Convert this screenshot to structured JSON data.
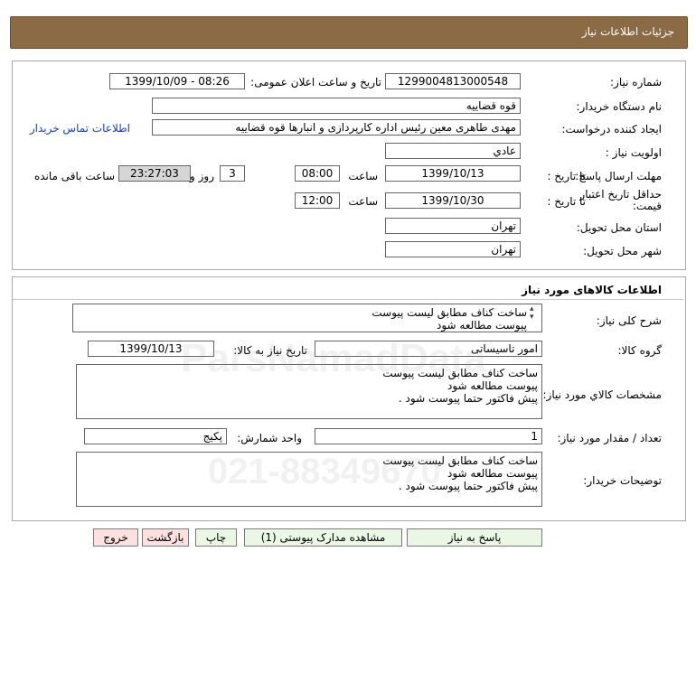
{
  "header": {
    "title": "جزئیات اطلاعات نیاز"
  },
  "need": {
    "need_number_label": "شماره نیاز:",
    "need_number": "1299004813000548",
    "announce_label": "تاریخ و ساعت اعلان عمومی:",
    "announce_value": "1399/10/09 - 08:26",
    "buyer_org_label": "نام دستگاه خریدار:",
    "buyer_org": "قوه قضاییه",
    "requester_label": "ایجاد کننده درخواست:",
    "requester": "مهدی طاهری معین رئیس اداره کارپردازی و انبارها قوه قضاییه",
    "contact_link": "اطلاعات تماس خریدار",
    "priority_label": "اولویت نیاز :",
    "priority": "عادي",
    "deadline_label": "مهلت ارسال پاسخ:",
    "to_date_label": "تا تاریخ :",
    "deadline_date": "1399/10/13",
    "time_label": "ساعت",
    "deadline_time": "08:00",
    "days_value": "3",
    "days_label": "روز و",
    "remaining_time": "23:27:03",
    "remaining_label": "ساعت باقی مانده",
    "validity_label": "حداقل تاریخ اعتبار قیمت:",
    "validity_to_label": "تا تاریخ :",
    "validity_date": "1399/10/30",
    "validity_time_label": "ساعت",
    "validity_time": "12:00",
    "province_label": "استان محل تحویل:",
    "province": "تهران",
    "city_label": "شهر محل تحویل:",
    "city": "تهران"
  },
  "goods": {
    "title": "اطلاعات کالاهای مورد نیاز",
    "desc_label": "شرح کلی نیاز:",
    "desc_lines": [
      "ساخت کناف مطابق لیست پیوست",
      "پیوست مطالعه شود"
    ],
    "group_label": "گروه کالا:",
    "group_value": "امور تاسیساتی",
    "need_date_label": "تاریخ نیاز به کالا:",
    "need_date": "1399/10/13",
    "specs_label": "مشخصات کالاي مورد نیاز:",
    "specs_lines": [
      "ساخت کناف مطابق لیست پیوست",
      "پیوست مطالعه شود",
      "پیش فاکتور حتما پیوست شود ."
    ],
    "qty_label": "تعداد / مقدار مورد نیاز:",
    "qty": "1",
    "unit_label": "واحد شمارش:",
    "unit": "پکیج",
    "buyer_notes_label": "توضیحات خریدار:",
    "buyer_notes_lines": [
      "ساخت کناف مطابق لیست پیوست",
      "پیوست مطالعه شود",
      "پیش فاکتور حتما پیوست شود ."
    ]
  },
  "buttons": {
    "reply": "پاسخ به نیاز",
    "attachments": "مشاهده مدارک پیوستی (1)",
    "print": "چاپ",
    "back": "بازگشت",
    "exit": "خروج"
  },
  "watermark": {
    "brand": "ParsNamadData",
    "phone": "021-88349670"
  }
}
